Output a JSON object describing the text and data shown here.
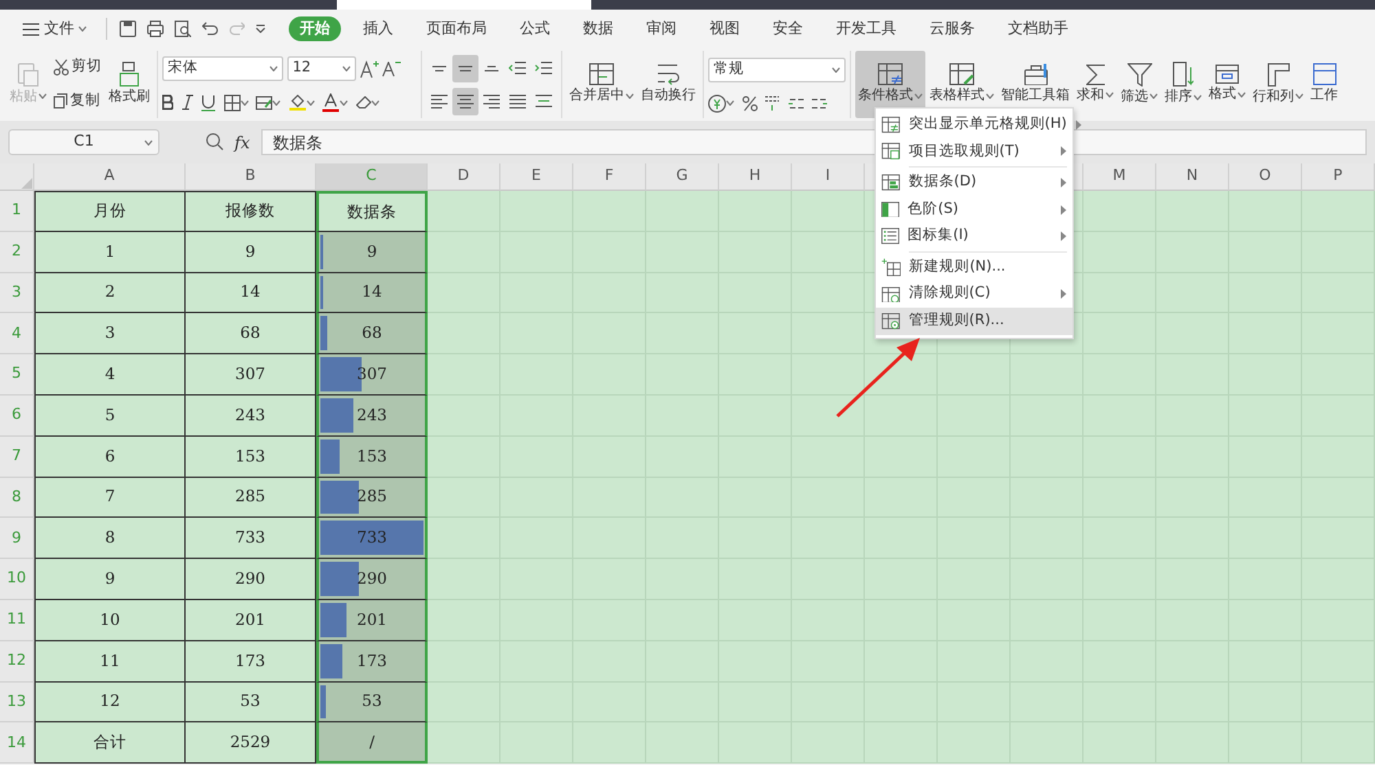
{
  "menu_bar": {
    "file": "文件",
    "tabs": [
      {
        "label": "开始",
        "selected": true
      },
      {
        "label": "插入",
        "selected": false
      },
      {
        "label": "页面布局",
        "selected": false
      },
      {
        "label": "公式",
        "selected": false
      },
      {
        "label": "数据",
        "selected": false
      },
      {
        "label": "审阅",
        "selected": false
      },
      {
        "label": "视图",
        "selected": false
      },
      {
        "label": "安全",
        "selected": false
      },
      {
        "label": "开发工具",
        "selected": false
      },
      {
        "label": "云服务",
        "selected": false
      },
      {
        "label": "文档助手",
        "selected": false
      }
    ]
  },
  "ribbon": {
    "clipboard": [
      {
        "label": "粘贴",
        "disabled": true
      },
      {
        "label": "剪切",
        "disabled": false
      },
      {
        "label": "复制",
        "disabled": false
      },
      {
        "label": "格式刷",
        "disabled": false
      }
    ],
    "font": {
      "name": "宋体",
      "size": "12"
    },
    "alignment": [
      {
        "selected": false
      },
      {
        "selected": true
      },
      {
        "selected": false
      },
      {
        "selected": false
      },
      {
        "selected": false
      },
      {
        "selected": false
      },
      {
        "selected": true
      },
      {
        "selected": false
      },
      {
        "selected": false
      },
      {
        "selected": false
      }
    ],
    "layout_buttons": [
      {
        "label": "合并居中",
        "dropdown": true,
        "selected": false
      },
      {
        "label": "自动换行",
        "dropdown": false,
        "selected": false
      }
    ],
    "number_format": "常规",
    "tool_buttons": [
      {
        "label": "条件格式",
        "dropdown": true,
        "selected": true
      },
      {
        "label": "表格样式",
        "dropdown": true,
        "selected": false
      },
      {
        "label": "智能工具箱",
        "dropdown": false,
        "selected": false
      },
      {
        "label": "求和",
        "dropdown": true,
        "selected": false
      },
      {
        "label": "筛选",
        "dropdown": true,
        "selected": false
      },
      {
        "label": "排序",
        "dropdown": true,
        "selected": false
      },
      {
        "label": "格式",
        "dropdown": true,
        "selected": false
      },
      {
        "label": "行和列",
        "dropdown": true,
        "selected": false
      },
      {
        "label": "工作",
        "dropdown": false,
        "selected": false
      }
    ]
  },
  "formula_bar": {
    "cell": "C1",
    "fx": "fx",
    "value": "数据条"
  },
  "sheet": {
    "columns": [
      {
        "label": "A",
        "selected": false
      },
      {
        "label": "B",
        "selected": false
      },
      {
        "label": "C",
        "selected": true
      },
      {
        "label": "D",
        "selected": false
      },
      {
        "label": "E",
        "selected": false
      },
      {
        "label": "F",
        "selected": false
      },
      {
        "label": "G",
        "selected": false
      },
      {
        "label": "H",
        "selected": false
      },
      {
        "label": "I",
        "selected": false
      },
      {},
      {},
      {},
      {
        "label": "M",
        "selected": false
      },
      {
        "label": "N",
        "selected": false
      },
      {
        "label": "O",
        "selected": false
      },
      {
        "label": "P",
        "selected": false
      }
    ],
    "rows": [
      {
        "number": "1",
        "cells": [
          "月份",
          "报修数",
          "数据条"
        ]
      },
      {
        "number": "2",
        "cells": [
          "1",
          "9",
          "9"
        ],
        "level": 0.012
      },
      {
        "number": "3",
        "cells": [
          "2",
          "14",
          "14"
        ],
        "level": 0.019
      },
      {
        "number": "4",
        "cells": [
          "3",
          "68",
          "68"
        ],
        "level": 0.093
      },
      {
        "number": "5",
        "cells": [
          "4",
          "307",
          "307"
        ],
        "level": 0.419
      },
      {
        "number": "6",
        "cells": [
          "5",
          "243",
          "243"
        ],
        "level": 0.332
      },
      {
        "number": "7",
        "cells": [
          "6",
          "153",
          "153"
        ],
        "level": 0.209
      },
      {
        "number": "8",
        "cells": [
          "7",
          "285",
          "285"
        ],
        "level": 0.389
      },
      {
        "number": "9",
        "cells": [
          "8",
          "733",
          "733"
        ],
        "level": 1
      },
      {
        "number": "10",
        "cells": [
          "9",
          "290",
          "290"
        ],
        "level": 0.396
      },
      {
        "number": "11",
        "cells": [
          "10",
          "201",
          "201"
        ],
        "level": 0.274
      },
      {
        "number": "12",
        "cells": [
          "11",
          "173",
          "173"
        ],
        "level": 0.236
      },
      {
        "number": "13",
        "cells": [
          "12",
          "53",
          "53"
        ],
        "level": 0.072
      },
      {
        "number": "14",
        "cells": [
          "合计",
          "2529",
          "/"
        ]
      }
    ]
  },
  "conditional_menu": {
    "groups": [
      [
        {
          "label": "突出显示单元格规则(H)",
          "submenu": true,
          "selected": false
        },
        {
          "label": "项目选取规则(T)",
          "submenu": true,
          "selected": false
        }
      ],
      [
        {
          "label": "数据条(D)",
          "submenu": true,
          "selected": false
        },
        {
          "label": "色阶(S)",
          "submenu": true,
          "selected": false
        },
        {
          "label": "图标集(I)",
          "submenu": true,
          "selected": false
        }
      ],
      [
        {
          "label": "新建规则(N)...",
          "submenu": false,
          "selected": false
        },
        {
          "label": "清除规则(C)",
          "submenu": true,
          "selected": false
        },
        {
          "label": "管理规则(R)...",
          "submenu": false,
          "selected": true
        }
      ]
    ]
  }
}
